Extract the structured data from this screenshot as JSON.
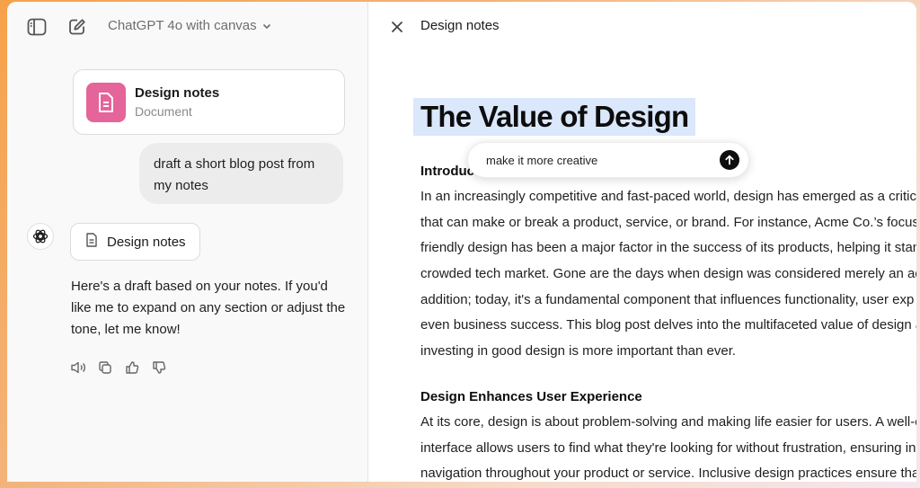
{
  "left": {
    "model_picker": "ChatGPT 4o with canvas",
    "doc_card": {
      "title": "Design notes",
      "subtitle": "Document"
    },
    "user_message": "draft a short blog post from my notes",
    "assistant": {
      "doc_chip": "Design notes",
      "message": "Here's a draft based on your notes. If you'd like me to expand on any section or adjust the tone, let me know!"
    },
    "icons": [
      "sidebar-toggle-icon",
      "new-chat-icon",
      "chevron-down-icon",
      "document-icon",
      "openai-logo-icon",
      "speaker-icon",
      "copy-icon",
      "thumbs-up-icon",
      "thumbs-down-icon"
    ]
  },
  "canvas": {
    "title": "Design notes",
    "heading": "The Value of Design",
    "prompt_input": "make it more creative",
    "sections": [
      {
        "heading": "Introduction",
        "lines": [
          "In an increasingly competitive and fast-paced world, design has emerged as a critical",
          "that can make or break a product, service, or brand. For instance, Acme Co.’s focus on",
          "friendly design has been a major factor in the success of its products, helping it stand",
          "crowded tech market. Gone are the days when design was considered merely an aes",
          "addition; today, it's a fundamental component that influences functionality, user exp",
          "even business success. This blog post delves into the multifaceted value of design a",
          "investing in good design is more important than ever."
        ]
      },
      {
        "heading": "Design Enhances User Experience",
        "lines": [
          "At its core, design is about problem-solving and making life easier for users. A well-c",
          "interface allows users to find what they're looking for without frustration, ensuring in",
          "navigation throughout your product or service. Inclusive design practices ensure that"
        ]
      }
    ]
  },
  "colors": {
    "doc_tile": "#e5649a",
    "heading_highlight": "#dbe7fb",
    "send_button": "#0d0d0d"
  }
}
